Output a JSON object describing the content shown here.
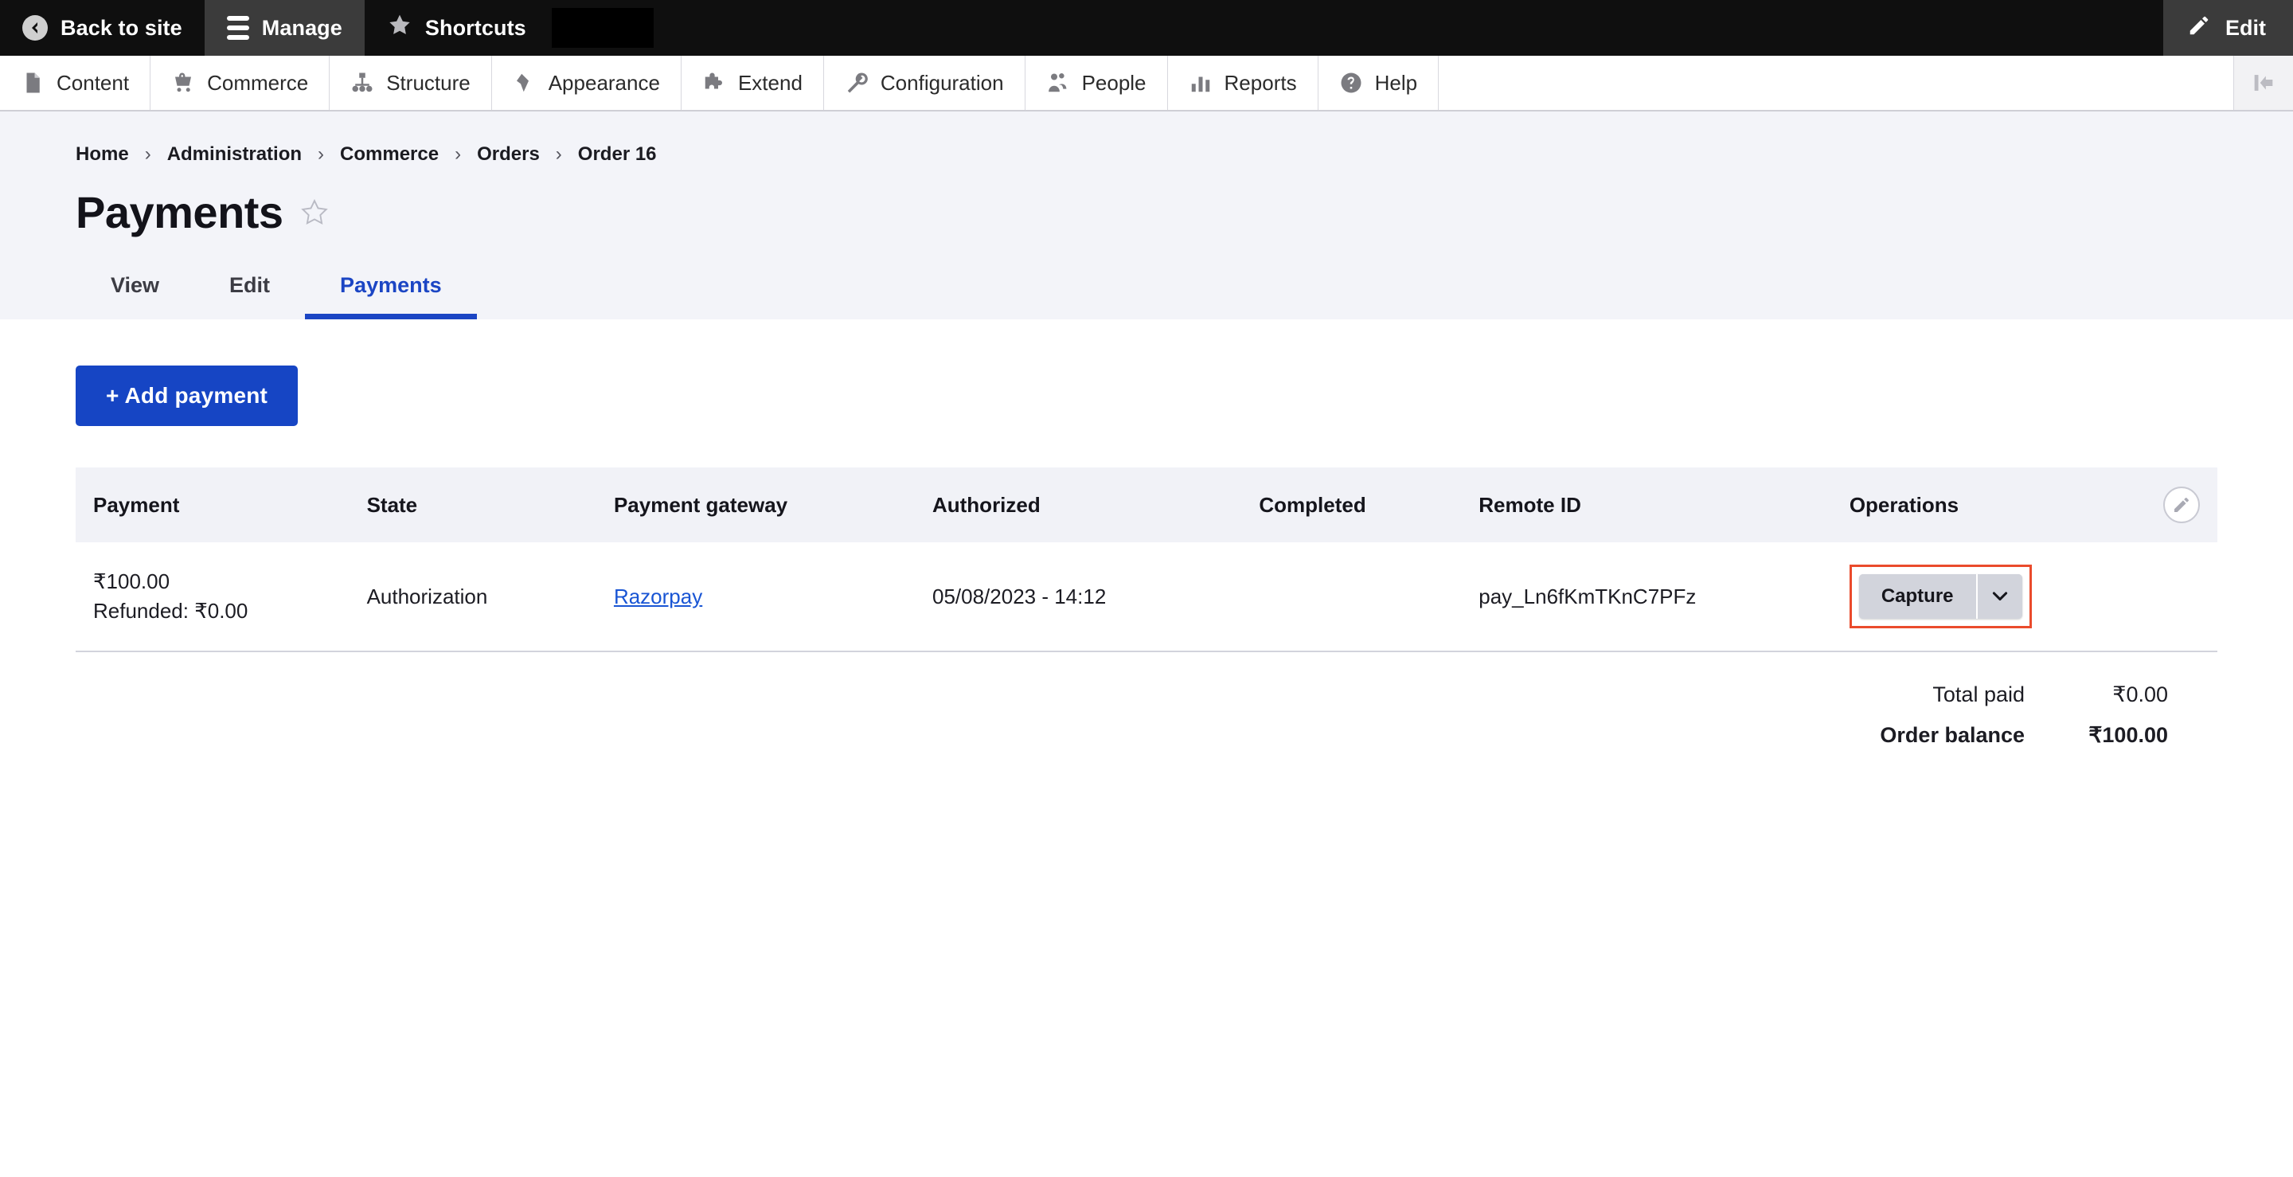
{
  "toolbar": {
    "back_to_site": "Back to site",
    "manage": "Manage",
    "shortcuts": "Shortcuts",
    "edit": "Edit"
  },
  "menubar": {
    "items": [
      {
        "label": "Content",
        "icon": "document-icon"
      },
      {
        "label": "Commerce",
        "icon": "shopping-cart-icon"
      },
      {
        "label": "Structure",
        "icon": "hierarchy-icon"
      },
      {
        "label": "Appearance",
        "icon": "paintbrush-icon"
      },
      {
        "label": "Extend",
        "icon": "puzzle-piece-icon"
      },
      {
        "label": "Configuration",
        "icon": "wrench-icon"
      },
      {
        "label": "People",
        "icon": "people-icon"
      },
      {
        "label": "Reports",
        "icon": "bar-chart-icon"
      },
      {
        "label": "Help",
        "icon": "question-mark-icon"
      }
    ],
    "collapse_icon": "collapse-sidebar-icon"
  },
  "breadcrumb": [
    "Home",
    "Administration",
    "Commerce",
    "Orders",
    "Order 16"
  ],
  "breadcrumb_separator": "›",
  "page": {
    "title": "Payments",
    "star_icon": "star-outline-icon"
  },
  "tabs": [
    {
      "label": "View",
      "active": false
    },
    {
      "label": "Edit",
      "active": false
    },
    {
      "label": "Payments",
      "active": true
    }
  ],
  "actions": {
    "add_payment": "+ Add payment"
  },
  "table": {
    "headers": [
      "Payment",
      "State",
      "Payment gateway",
      "Authorized",
      "Completed",
      "Remote ID",
      "Operations"
    ],
    "edit_icon": "pencil-icon",
    "rows": [
      {
        "amount": "₹100.00",
        "refunded": "Refunded: ₹0.00",
        "state": "Authorization",
        "gateway": "Razorpay",
        "authorized": "05/08/2023 - 14:12",
        "completed": "",
        "remote_id": "pay_Ln6fKmTKnC7PFz",
        "operation_label": "Capture",
        "operation_toggle_icon": "chevron-down-icon"
      }
    ]
  },
  "totals": [
    {
      "label": "Total paid",
      "value": "₹0.00",
      "bold": false
    },
    {
      "label": "Order balance",
      "value": "₹100.00",
      "bold": true
    }
  ],
  "colors": {
    "accent_blue": "#1645c4",
    "highlight_red": "#ea4b2c",
    "toolbar_dark": "#0f0f0f",
    "header_bg": "#f3f4f9"
  }
}
